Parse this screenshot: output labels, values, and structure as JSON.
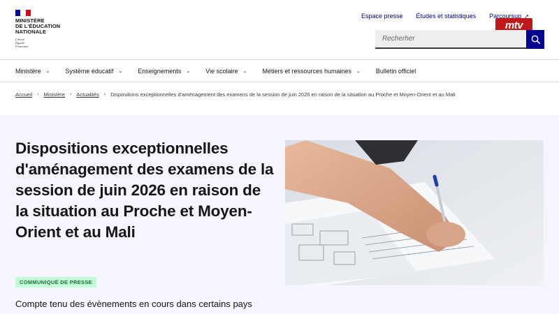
{
  "header": {
    "logo_lines": [
      "MINISTÈRE",
      "DE L'ÉDUCATION",
      "NATIONALE"
    ],
    "motto_lines": [
      "Liberté",
      "Égalité",
      "Fraternité"
    ],
    "top_links": [
      "Espace presse",
      "Études et statistiques",
      "Parcoursup"
    ],
    "overlay_logo": "mtv",
    "search_placeholder": "Recherher",
    "colors": {
      "primary": "#000091",
      "flag_blue": "#000091",
      "flag_red": "#e1000f"
    }
  },
  "nav": {
    "items": [
      "Ministère",
      "Système éducatif",
      "Enseignements",
      "Vie scolaire",
      "Métiers et ressources humaines",
      "Bulletin officiel"
    ]
  },
  "breadcrumb": {
    "links": [
      "Accueil",
      "Ministère",
      "Actualités"
    ],
    "current": "Dispositions exceptionnelles d'aménagement des examens de la session de juin 2026 en raison de la situation au Proche et Moyen-Orient et au Mali"
  },
  "hero": {
    "title": "Dispositions exceptionnelles d'aménagement des examens de la session de juin 2026 en raison de la situation au Proche et Moyen-Orient et au Mali",
    "badge": "COMMUNIQUÉ DE PRESSE",
    "intro": "Compte tenu des évènements en cours dans certains pays",
    "image_description_icon": "student-writing-exam-photo"
  }
}
